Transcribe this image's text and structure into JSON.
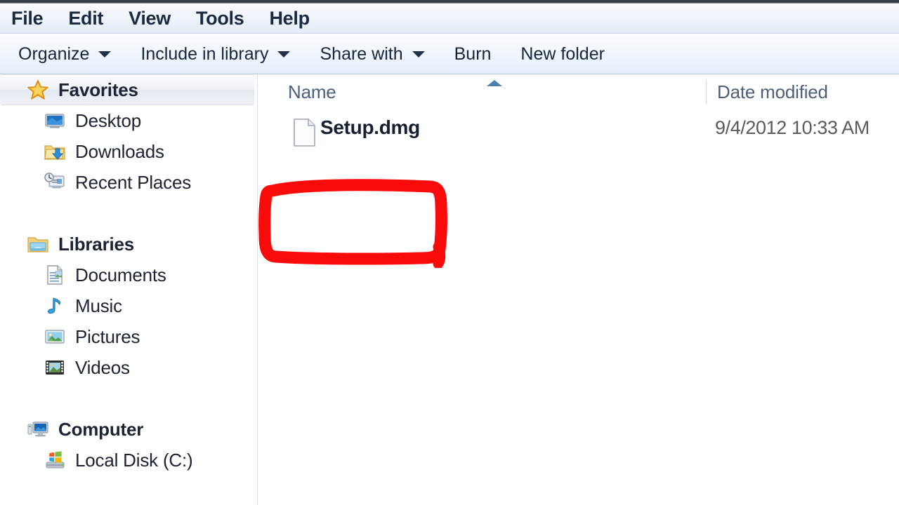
{
  "window": {
    "app": "Windows Explorer"
  },
  "menubar": {
    "items": [
      {
        "label": "File",
        "name": "menu-file"
      },
      {
        "label": "Edit",
        "name": "menu-edit"
      },
      {
        "label": "View",
        "name": "menu-view"
      },
      {
        "label": "Tools",
        "name": "menu-tools"
      },
      {
        "label": "Help",
        "name": "menu-help"
      }
    ]
  },
  "toolbar": {
    "buttons": [
      {
        "label": "Organize",
        "caret": true,
        "name": "toolbar-organize"
      },
      {
        "label": "Include in library",
        "caret": true,
        "name": "toolbar-include-in-library"
      },
      {
        "label": "Share with",
        "caret": true,
        "name": "toolbar-share-with"
      },
      {
        "label": "Burn",
        "caret": false,
        "name": "toolbar-burn"
      },
      {
        "label": "New folder",
        "caret": false,
        "name": "toolbar-new-folder"
      }
    ]
  },
  "sidebar": {
    "groups": [
      {
        "header": {
          "label": "Favorites",
          "icon": "star-icon",
          "highlighted": true
        },
        "items": [
          {
            "label": "Desktop",
            "icon": "desktop-icon"
          },
          {
            "label": "Downloads",
            "icon": "downloads-folder-icon"
          },
          {
            "label": "Recent Places",
            "icon": "recent-places-icon"
          }
        ]
      },
      {
        "header": {
          "label": "Libraries",
          "icon": "libraries-folder-icon",
          "highlighted": false
        },
        "items": [
          {
            "label": "Documents",
            "icon": "documents-icon"
          },
          {
            "label": "Music",
            "icon": "music-note-icon"
          },
          {
            "label": "Pictures",
            "icon": "pictures-icon"
          },
          {
            "label": "Videos",
            "icon": "videos-filmstrip-icon"
          }
        ]
      },
      {
        "header": {
          "label": "Computer",
          "icon": "computer-icon",
          "highlighted": false
        },
        "items": [
          {
            "label": "Local Disk (C:)",
            "icon": "local-disk-icon"
          }
        ]
      }
    ]
  },
  "filepane": {
    "columns": {
      "name": "Name",
      "date_modified": "Date modified"
    },
    "sort": {
      "column": "Name",
      "direction": "ascending"
    },
    "rows": [
      {
        "name": "Setup.dmg",
        "date_modified": "9/4/2012 10:33 AM",
        "icon": "generic-file-icon",
        "annotated": true
      }
    ]
  },
  "annotation": {
    "shape": "rounded-rectangle",
    "color": "#fb0a0a",
    "target": "Setup.dmg"
  }
}
